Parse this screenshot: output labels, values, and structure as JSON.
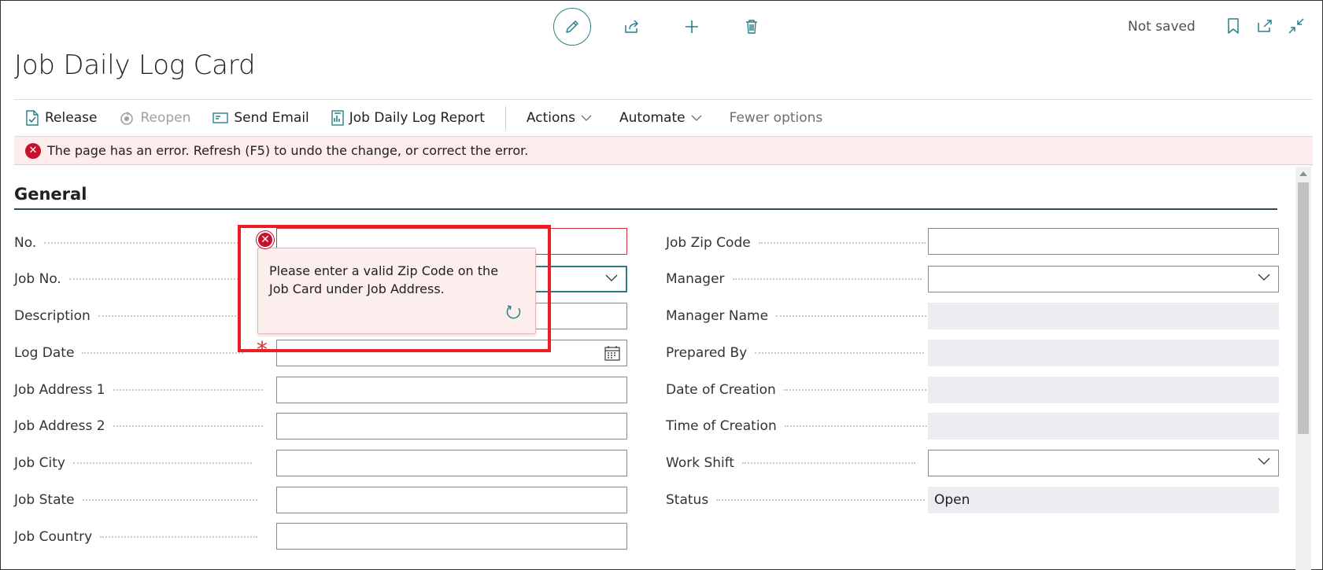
{
  "header": {
    "status": "Not saved",
    "title": "Job Daily Log Card"
  },
  "toolbar": {
    "release": "Release",
    "reopen": "Reopen",
    "send_email": "Send Email",
    "report": "Job Daily Log Report",
    "actions": "Actions",
    "automate": "Automate",
    "fewer": "Fewer options"
  },
  "error_bar": {
    "message": "The page has an error. Refresh (F5) to undo the change, or correct the error."
  },
  "section": {
    "title": "General"
  },
  "left_fields": [
    {
      "label": "No.",
      "value": ""
    },
    {
      "label": "Job No.",
      "value": ""
    },
    {
      "label": "Description",
      "value": ""
    },
    {
      "label": "Log Date",
      "value": ""
    },
    {
      "label": "Job Address 1",
      "value": ""
    },
    {
      "label": "Job Address 2",
      "value": ""
    },
    {
      "label": "Job City",
      "value": ""
    },
    {
      "label": "Job State",
      "value": ""
    },
    {
      "label": "Job Country",
      "value": ""
    }
  ],
  "right_fields": [
    {
      "label": "Job Zip Code",
      "value": ""
    },
    {
      "label": "Manager",
      "value": ""
    },
    {
      "label": "Manager Name",
      "value": ""
    },
    {
      "label": "Prepared By",
      "value": ""
    },
    {
      "label": "Date of Creation",
      "value": ""
    },
    {
      "label": "Time of Creation",
      "value": ""
    },
    {
      "label": "Work Shift",
      "value": ""
    },
    {
      "label": "Status",
      "value": "Open"
    }
  ],
  "validation": {
    "message": "Please enter a valid Zip Code on the Job Card under Job Address.",
    "required_mark": "*"
  },
  "colors": {
    "accent": "#2a7f86",
    "error": "#c8102e",
    "error_bg": "#fcecec",
    "highlight": "#ee1c24"
  }
}
